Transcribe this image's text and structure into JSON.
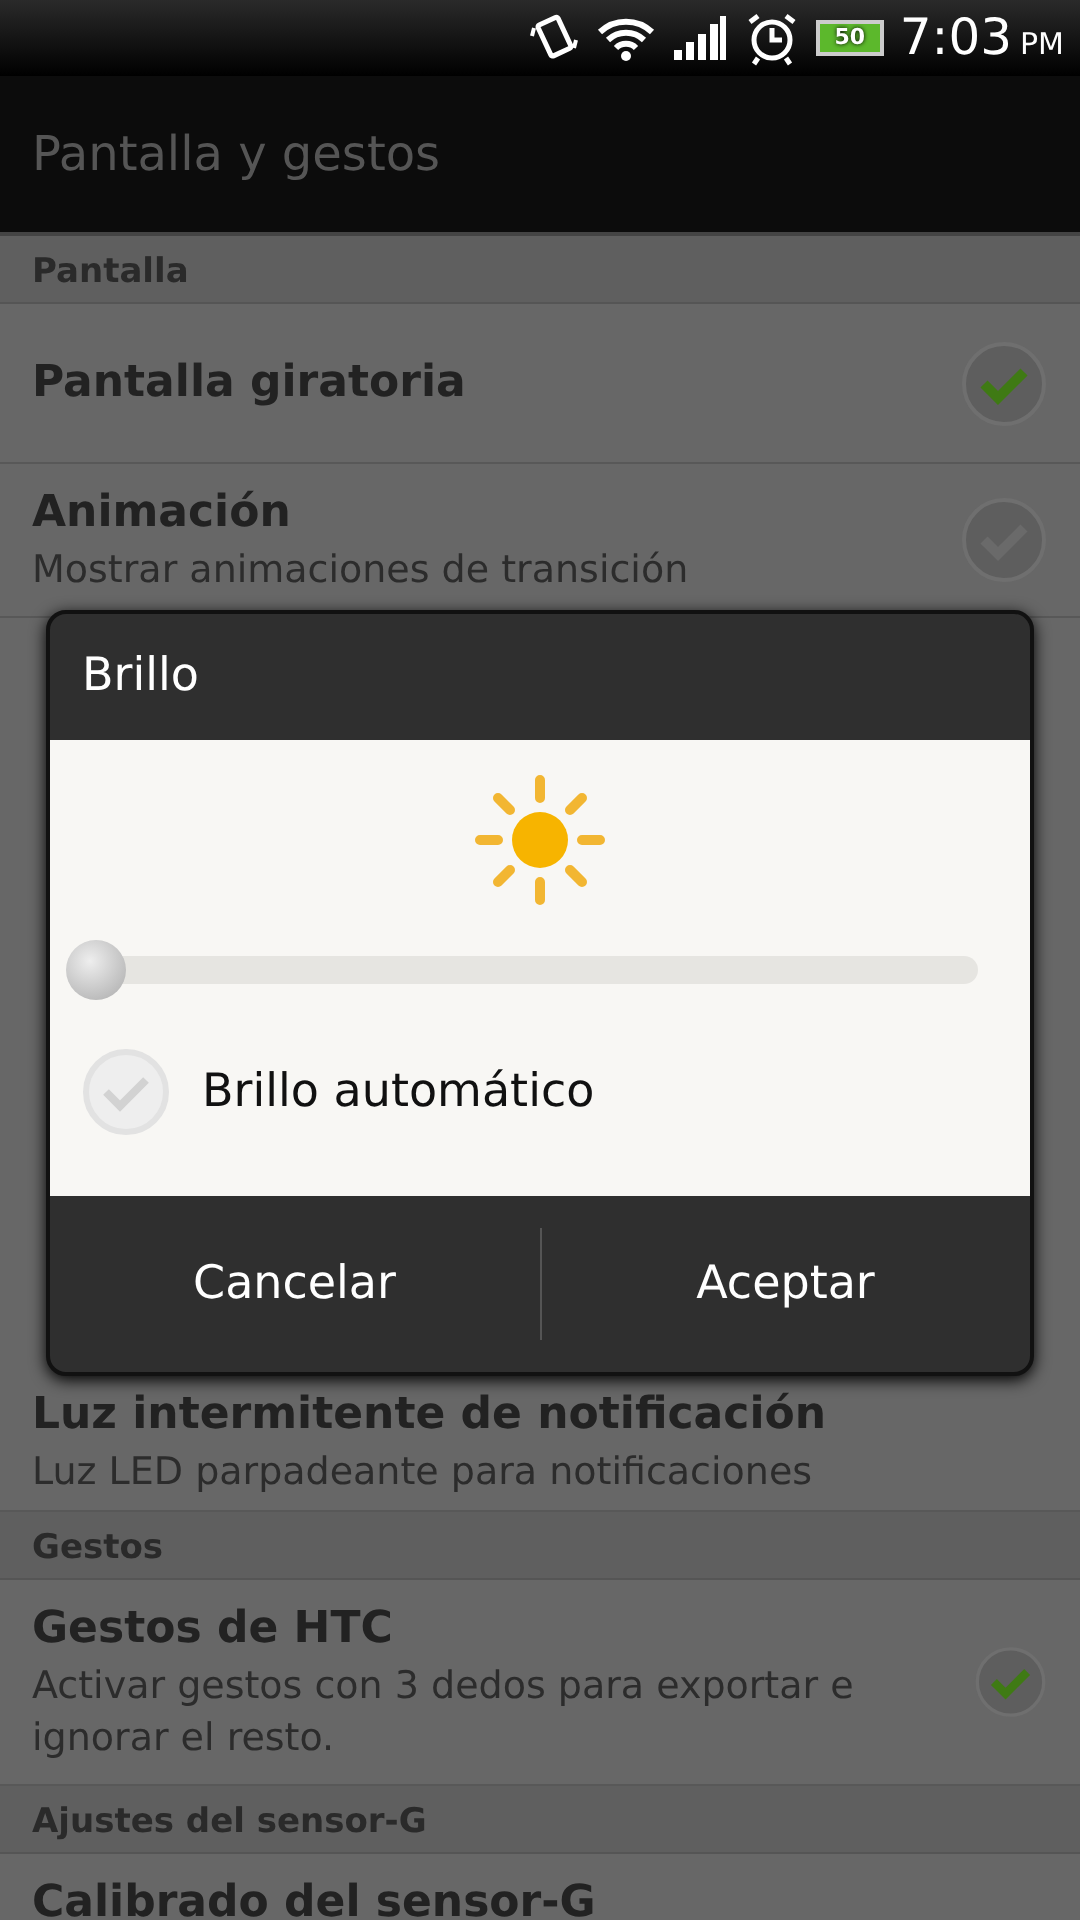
{
  "status_bar": {
    "time": "7:03",
    "ampm": "PM",
    "battery": "50"
  },
  "title_bar": {
    "title": "Pantalla y gestos"
  },
  "list": [
    {
      "kind": "header",
      "title": "Pantalla"
    },
    {
      "kind": "item",
      "title": "Pantalla giratoria",
      "checked": true
    },
    {
      "kind": "item",
      "title": "Animación",
      "subtitle": "Mostrar animaciones de transición",
      "checked": false
    },
    {
      "kind": "hidden"
    },
    {
      "kind": "item",
      "title": "Luz intermitente de notificación",
      "subtitle": "Luz LED parpadeante para notificaciones"
    },
    {
      "kind": "header",
      "title": "Gestos"
    },
    {
      "kind": "item",
      "title": "Gestos de HTC",
      "subtitle": "Activar gestos con 3 dedos para exportar e ignorar el resto.",
      "checked": true
    },
    {
      "kind": "header",
      "title": "Ajustes del sensor-G"
    },
    {
      "kind": "item",
      "title": "Calibrado del sensor-G"
    }
  ],
  "dialog": {
    "title": "Brillo",
    "slider": {
      "level": 0.0
    },
    "auto": {
      "label": "Brillo automático",
      "checked": false
    },
    "buttons": [
      "Cancelar",
      "Aceptar"
    ]
  }
}
